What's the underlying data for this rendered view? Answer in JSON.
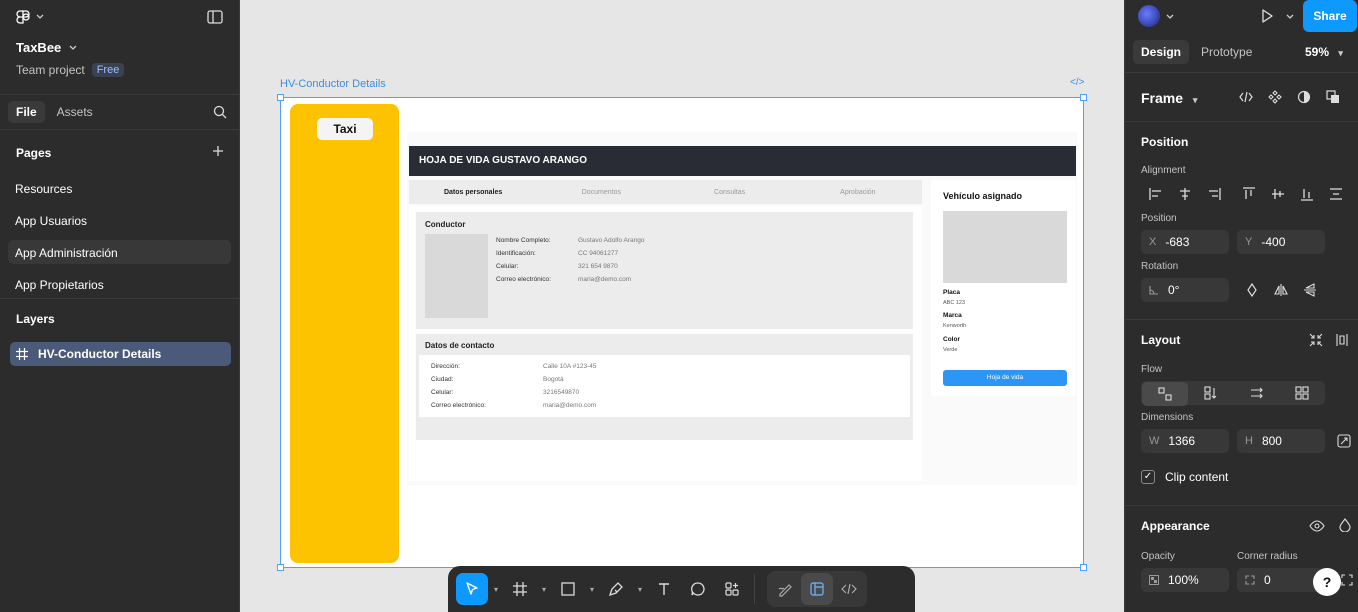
{
  "left_panel": {
    "project_name": "TaxBee",
    "project_type": "Team project",
    "plan_badge": "Free",
    "tabs": [
      "File",
      "Assets"
    ],
    "pages_heading": "Pages",
    "pages": [
      "Resources",
      "App Usuarios",
      "App Administración",
      "App Propietarios"
    ],
    "layers_heading": "Layers",
    "layers": [
      "HV-Conductor Details"
    ]
  },
  "canvas": {
    "frame_name": "HV-Conductor Details",
    "frame_code": "</>",
    "design": {
      "taxi_button": "Taxi",
      "header_title": "HOJA DE VIDA GUSTAVO ARANGO",
      "tabs": [
        "Datos personales",
        "Documentos",
        "Consultas",
        "Aprobación"
      ],
      "conductor": {
        "title": "Conductor",
        "labels": [
          "Nombre Completo:",
          "Identificación:",
          "Celular:",
          "Correo electrónico:"
        ],
        "values": [
          "Gustavo Adolfo Arango",
          "CC 94061277",
          "321 654 9870",
          "maria@demo.com"
        ]
      },
      "contacto": {
        "title": "Datos de contacto",
        "labels": [
          "Dirección:",
          "Ciudad:",
          "Celular:",
          "Correo electrónico:"
        ],
        "values": [
          "Calle 10A #123-45",
          "Bogotá",
          "3216549870",
          "maria@demo.com"
        ]
      },
      "vehiculo": {
        "title": "Vehículo asignado",
        "placa_label": "Placa",
        "placa_value": "ABC 123",
        "marca_label": "Marca",
        "marca_value": "Kenworth",
        "color_label": "Color",
        "color_value": "Verde",
        "button": "Hoja de vida"
      }
    }
  },
  "right_panel": {
    "share_label": "Share",
    "tabs": [
      "Design",
      "Prototype"
    ],
    "zoom": "59%",
    "frame_label": "Frame",
    "position_heading": "Position",
    "alignment_label": "Alignment",
    "position_label": "Position",
    "x_label": "X",
    "x_value": "-683",
    "y_label": "Y",
    "y_value": "-400",
    "rotation_label": "Rotation",
    "rotation_value": "0°",
    "layout_heading": "Layout",
    "flow_label": "Flow",
    "dimensions_label": "Dimensions",
    "w_label": "W",
    "w_value": "1366",
    "h_label": "H",
    "h_value": "800",
    "clip_content": "Clip content",
    "appearance_heading": "Appearance",
    "opacity_label": "Opacity",
    "opacity_value": "100%",
    "corner_radius_label": "Corner radius",
    "corner_radius_value": "0",
    "help": "?"
  },
  "colors": {
    "accent": "#0d99ff",
    "sidebar_yellow": "#fdc300",
    "header_dark": "#2a2c35"
  }
}
